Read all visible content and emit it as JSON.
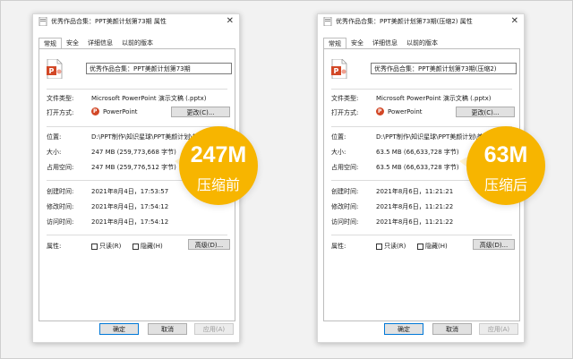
{
  "colors": {
    "badge": "#f7b500",
    "ppt_red": "#d24726",
    "background": "#f2f2f2"
  },
  "dialogs": [
    {
      "title": "优秀作品合集：PPT美颜计划第73期 属性",
      "tabs": [
        {
          "label": "常规",
          "active": true
        },
        {
          "label": "安全"
        },
        {
          "label": "详细信息"
        },
        {
          "label": "以前的版本"
        }
      ],
      "filename": "优秀作品合集：PPT美颜计划第73期",
      "file_type_label": "文件类型:",
      "file_type": "Microsoft PowerPoint 演示文稿 (.pptx)",
      "open_with_label": "打开方式:",
      "open_with": "PowerPoint",
      "change_button": "更改(C)...",
      "location_label": "位置:",
      "location": "D:\\PPT制作\\知识星球\\PPT美颜计划\\美颜",
      "size_label": "大小:",
      "size": "247 MB (259,773,668 字节)",
      "disk_label": "占用空间:",
      "disk": "247 MB (259,776,512 字节)",
      "created_label": "创建时间:",
      "created": "2021年8月4日，17:53:57",
      "modified_label": "修改时间:",
      "modified": "2021年8月4日，17:54:12",
      "accessed_label": "访问时间:",
      "accessed": "2021年8月4日，17:54:12",
      "attributes_label": "属性:",
      "readonly_label": "只读(R)",
      "hidden_label": "隐藏(H)",
      "advanced_button": "高级(D)...",
      "ok_button": "确定",
      "cancel_button": "取消",
      "apply_button": "应用(A)",
      "badge_big": "247M",
      "badge_small": "压缩前"
    },
    {
      "title": "优秀作品合集：PPT美颜计划第73期(压缩2) 属性",
      "tabs": [
        {
          "label": "常规",
          "active": true
        },
        {
          "label": "安全"
        },
        {
          "label": "详细信息"
        },
        {
          "label": "以前的版本"
        }
      ],
      "filename": "优秀作品合集：PPT美颜计划第73期(压缩2)",
      "file_type_label": "文件类型:",
      "file_type": "Microsoft PowerPoint 演示文稿 (.pptx)",
      "open_with_label": "打开方式:",
      "open_with": "PowerPoint",
      "change_button": "更改(C)...",
      "location_label": "位置:",
      "location": "D:\\PPT制作\\知识星球\\PPT美颜计划\\美颜",
      "size_label": "大小:",
      "size": "63.5 MB (66,633,728 字节)",
      "disk_label": "占用空间:",
      "disk": "63.5 MB (66,633,728 字节)",
      "created_label": "创建时间:",
      "created": "2021年8月6日，11:21:21",
      "modified_label": "修改时间:",
      "modified": "2021年8月6日，11:21:22",
      "accessed_label": "访问时间:",
      "accessed": "2021年8月6日，11:21:22",
      "attributes_label": "属性:",
      "readonly_label": "只读(R)",
      "hidden_label": "隐藏(H)",
      "advanced_button": "高级(D)...",
      "ok_button": "确定",
      "cancel_button": "取消",
      "apply_button": "应用(A)",
      "badge_big": "63M",
      "badge_small": "压缩后"
    }
  ]
}
